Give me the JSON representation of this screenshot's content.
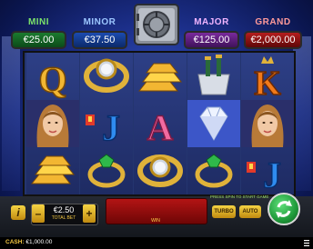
{
  "jackpots": {
    "mini": {
      "label": "MINI",
      "value": "€25.00"
    },
    "minor": {
      "label": "MINOR",
      "value": "€37.50"
    },
    "major": {
      "label": "MAJOR",
      "value": "€125.00"
    },
    "grand": {
      "label": "GRAND",
      "value": "€2,000.00"
    }
  },
  "reels": [
    [
      "queen-symbol",
      "lady-symbol",
      "gold-bars-symbol"
    ],
    [
      "watch-symbol",
      "jack-symbol",
      "emerald-ring-symbol"
    ],
    [
      "gold-bars-symbol",
      "ace-symbol",
      "watch-symbol"
    ],
    [
      "champagne-symbol",
      "diamond-symbol",
      "emerald-ring-symbol"
    ],
    [
      "king-symbol",
      "lady-symbol",
      "jack-symbol"
    ]
  ],
  "symbol_letters": {
    "queen": "Q",
    "jack": "J",
    "ace": "A",
    "king": "K"
  },
  "bet": {
    "value": "€2.50",
    "label": "TOTAL BET",
    "minus": "–",
    "plus": "+"
  },
  "info_label": "i",
  "win_label": "WIN",
  "press_spin": "PRESS SPIN TO START GAME",
  "buttons": {
    "turbo": "TURBO",
    "auto": "AUTO"
  },
  "cash": {
    "label": "CASH:",
    "value": "€1,000.00"
  },
  "colors": {
    "win_panel": "#b31414",
    "spin": "#1f9a3a",
    "accent_gold": "#f4c842"
  }
}
